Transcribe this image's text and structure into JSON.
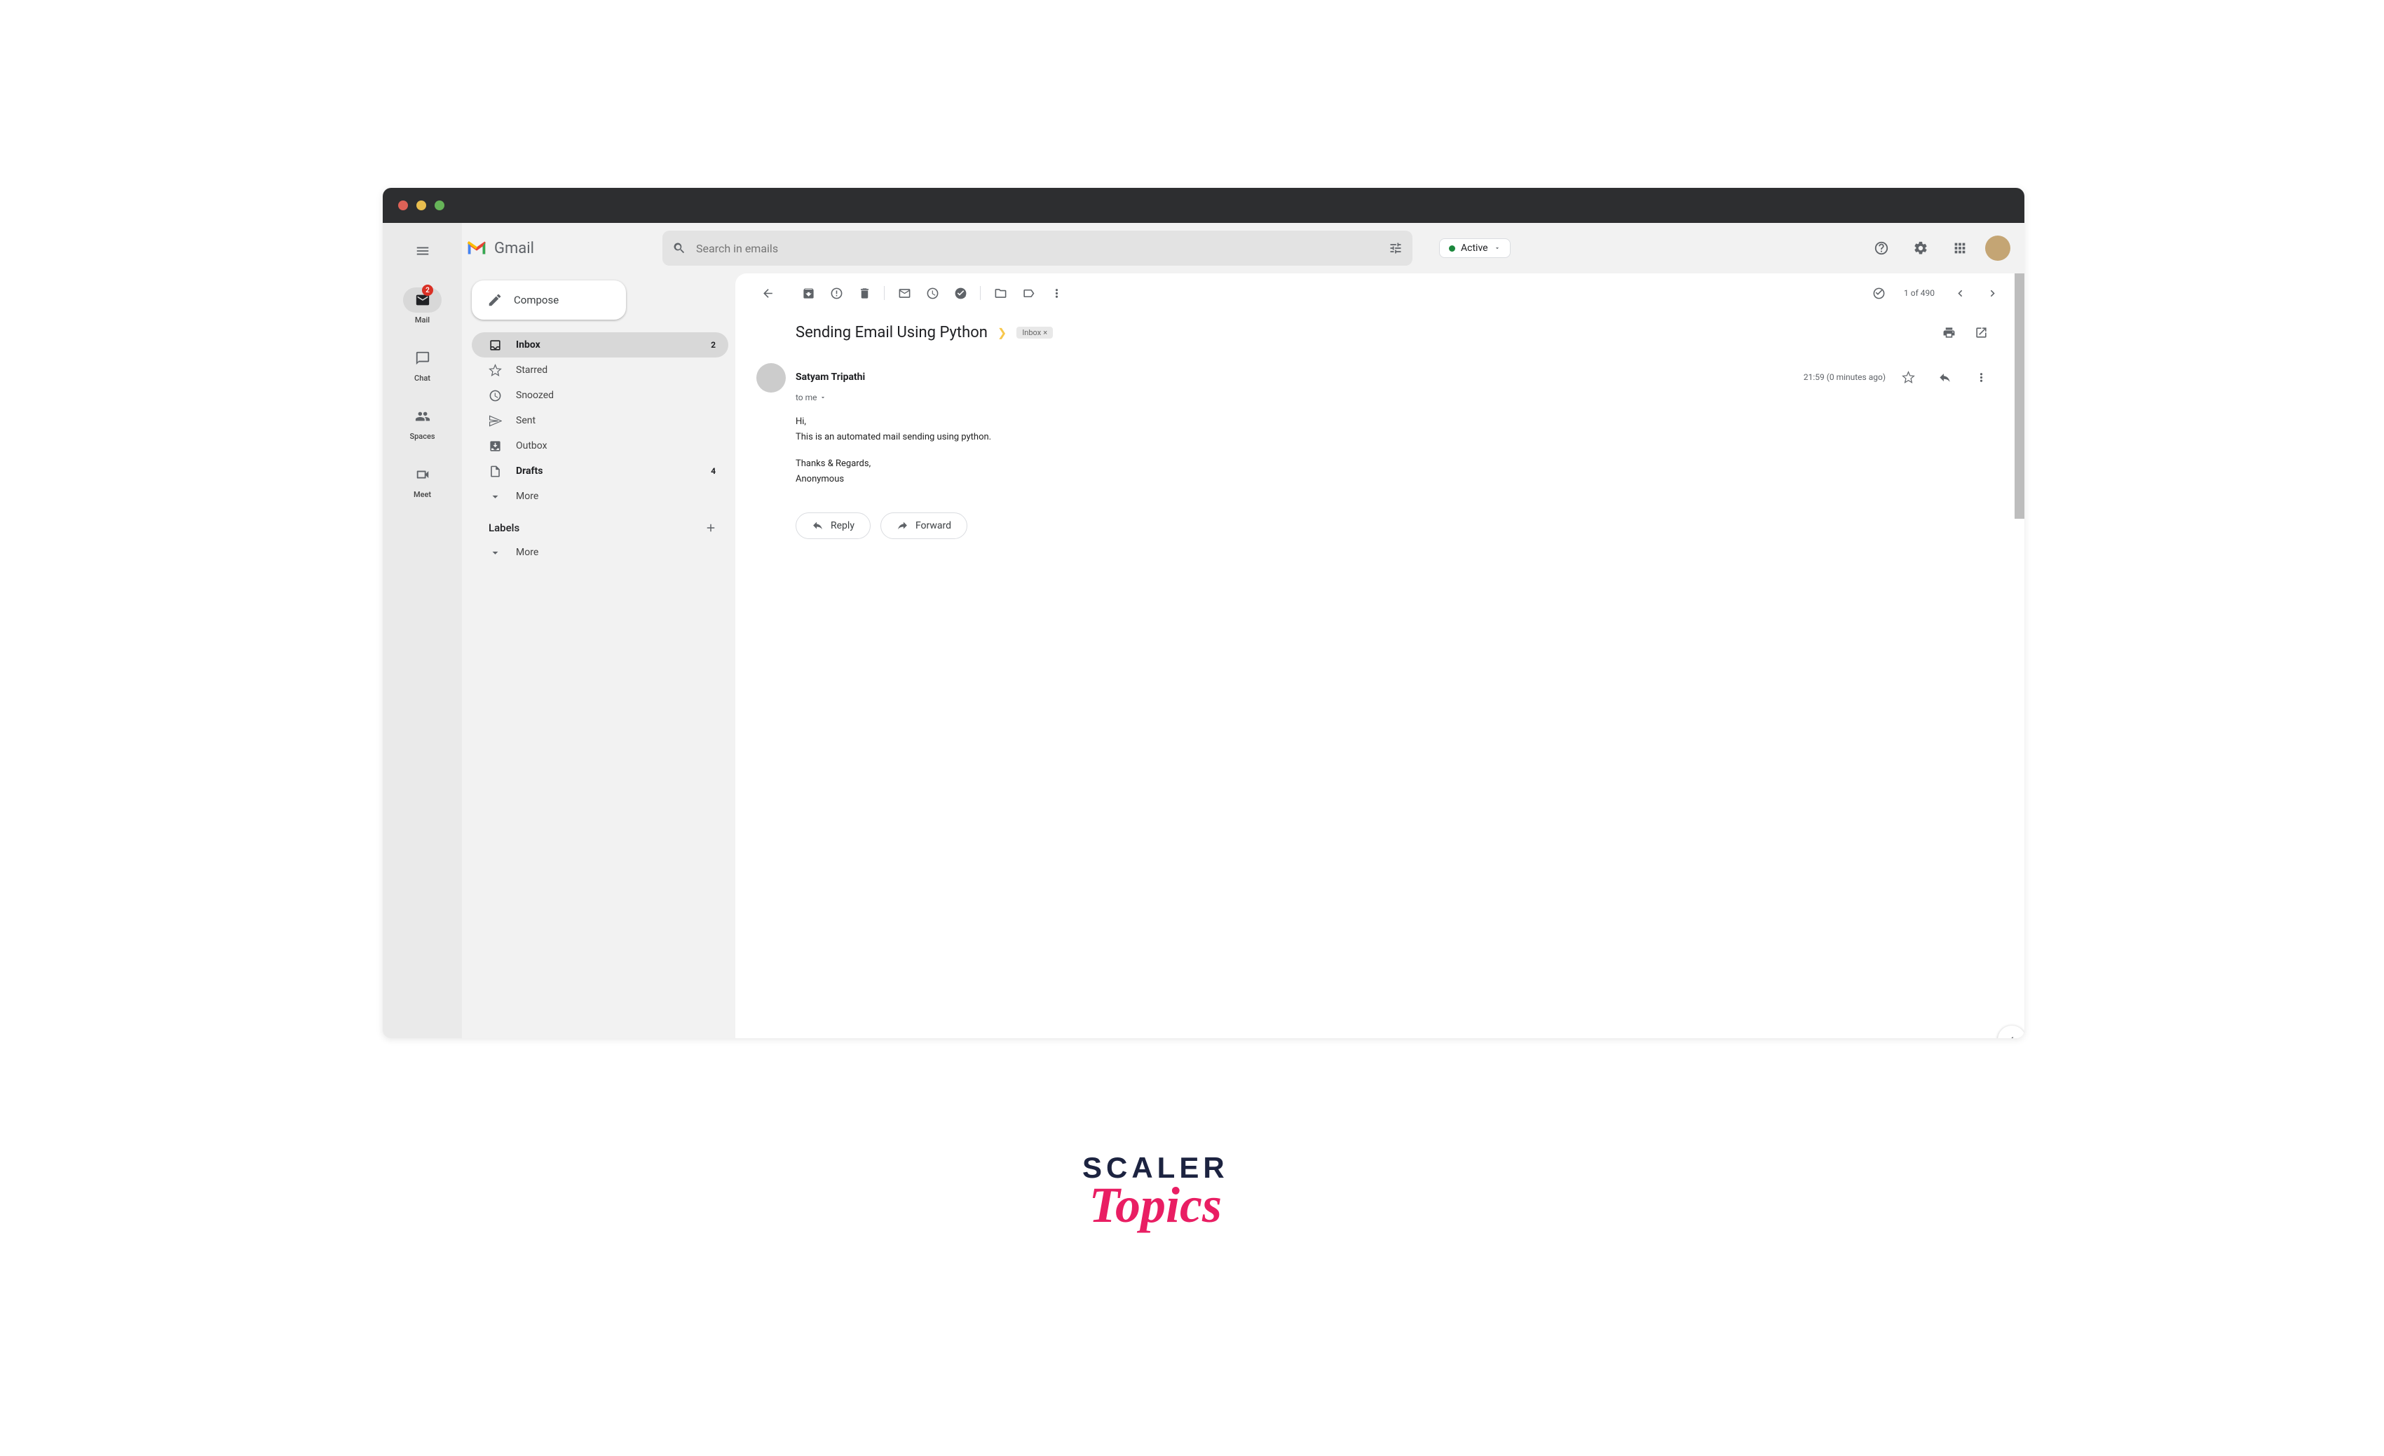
{
  "rail": {
    "mail": {
      "label": "Mail",
      "badge": "2"
    },
    "chat": {
      "label": "Chat"
    },
    "spaces": {
      "label": "Spaces"
    },
    "meet": {
      "label": "Meet"
    }
  },
  "header": {
    "app": "Gmail",
    "search_placeholder": "Search in emails",
    "status": "Active"
  },
  "sidebar": {
    "compose": "Compose",
    "items": [
      {
        "label": "Inbox",
        "count": "2"
      },
      {
        "label": "Starred",
        "count": ""
      },
      {
        "label": "Snoozed",
        "count": ""
      },
      {
        "label": "Sent",
        "count": ""
      },
      {
        "label": "Outbox",
        "count": ""
      },
      {
        "label": "Drafts",
        "count": "4"
      },
      {
        "label": "More",
        "count": ""
      }
    ],
    "labels_header": "Labels",
    "labels_more": "More"
  },
  "toolbar": {
    "page_info": "1 of 490"
  },
  "email": {
    "subject": "Sending Email Using Python",
    "chip": "Inbox",
    "from": "Satyam Tripathi",
    "to": "to me",
    "time": "21:59 (0 minutes ago)",
    "body_line1": "Hi,",
    "body_line2": "This is an automated mail sending using python.",
    "sig_line1": "Thanks & Regards,",
    "sig_line2": "Anonymous",
    "reply": "Reply",
    "forward": "Forward"
  },
  "brand": {
    "top": "SCALER",
    "bot": "Topics"
  }
}
